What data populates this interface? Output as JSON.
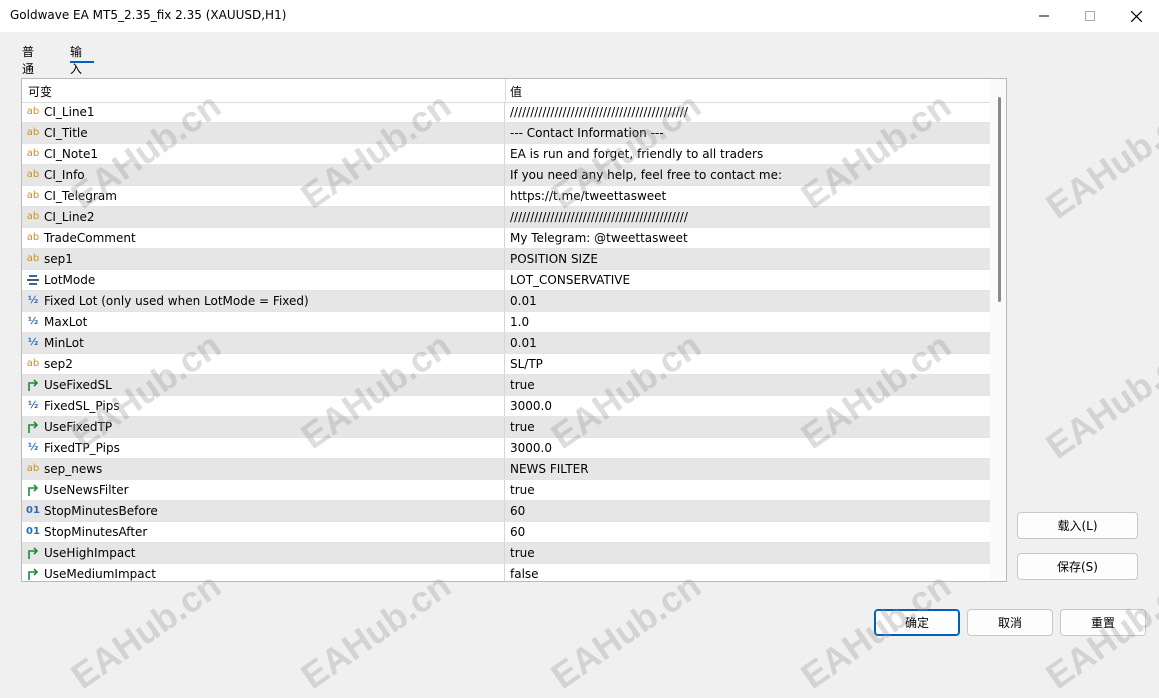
{
  "window": {
    "title": "Goldwave EA MT5_2.35_fix 2.35 (XAUUSD,H1)",
    "icons": [
      "minimize-icon",
      "maximize-icon",
      "close-icon"
    ]
  },
  "tabs": [
    "普通",
    "输入"
  ],
  "active_tab": "输入",
  "grid": {
    "headers": [
      "可变",
      "值"
    ],
    "rows": [
      {
        "type": "ab",
        "icon": "ab",
        "name": "CI_Line1",
        "value": "////////////////////////////////////////////"
      },
      {
        "type": "ab",
        "icon": "ab",
        "name": "CI_Title",
        "value": "--- Contact Information ---"
      },
      {
        "type": "ab",
        "icon": "ab",
        "name": "CI_Note1",
        "value": "EA is run and forget, friendly to all traders"
      },
      {
        "type": "ab",
        "icon": "ab",
        "name": "CI_Info",
        "value": "If you need any help, feel free to contact me:"
      },
      {
        "type": "ab",
        "icon": "ab",
        "name": "CI_Telegram",
        "value": "https://t.me/tweettasweet"
      },
      {
        "type": "ab",
        "icon": "ab",
        "name": "CI_Line2",
        "value": "////////////////////////////////////////////"
      },
      {
        "type": "ab",
        "icon": "ab",
        "name": "TradeComment",
        "value": "My Telegram: @tweettasweet"
      },
      {
        "type": "ab",
        "icon": "ab",
        "name": "sep1",
        "value": "POSITION SIZE"
      },
      {
        "type": "enum",
        "icon": "",
        "name": "LotMode",
        "value": "LOT_CONSERVATIVE"
      },
      {
        "type": "double",
        "icon": "½",
        "name": "Fixed Lot (only used when LotMode = Fixed)",
        "value": "0.01"
      },
      {
        "type": "double",
        "icon": "½",
        "name": "MaxLot",
        "value": "1.0"
      },
      {
        "type": "double",
        "icon": "½",
        "name": "MinLot",
        "value": "0.01"
      },
      {
        "type": "ab",
        "icon": "ab",
        "name": "sep2",
        "value": "SL/TP"
      },
      {
        "type": "bool",
        "icon": "",
        "name": "UseFixedSL",
        "value": "true"
      },
      {
        "type": "double",
        "icon": "½",
        "name": "FixedSL_Pips",
        "value": "3000.0"
      },
      {
        "type": "bool",
        "icon": "",
        "name": "UseFixedTP",
        "value": "true"
      },
      {
        "type": "double",
        "icon": "½",
        "name": "FixedTP_Pips",
        "value": "3000.0"
      },
      {
        "type": "ab",
        "icon": "ab",
        "name": "sep_news",
        "value": "NEWS FILTER"
      },
      {
        "type": "bool",
        "icon": "",
        "name": "UseNewsFilter",
        "value": "true"
      },
      {
        "type": "int",
        "icon": "01",
        "name": "StopMinutesBefore",
        "value": "60"
      },
      {
        "type": "int",
        "icon": "01",
        "name": "StopMinutesAfter",
        "value": "60"
      },
      {
        "type": "bool",
        "icon": "",
        "name": "UseHighImpact",
        "value": "true"
      },
      {
        "type": "bool",
        "icon": "",
        "name": "UseMediumImpact",
        "value": "false"
      }
    ]
  },
  "side_buttons": {
    "load": "载入(L)",
    "save": "保存(S)"
  },
  "footer_buttons": {
    "ok": "确定",
    "cancel": "取消",
    "reset": "重置"
  },
  "watermark": "EAHub.cn",
  "colors": {
    "accent": "#005fb8",
    "string_icon": "#c8902a",
    "number_icon": "#2b6cb0",
    "bool_icon": "#1f8a3b",
    "row_alt": "#e6e6e6"
  }
}
